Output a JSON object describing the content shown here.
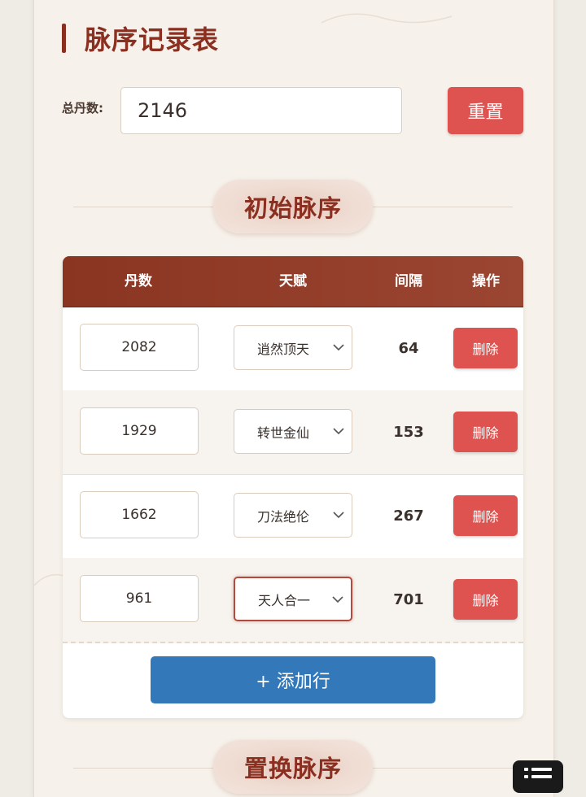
{
  "header": {
    "title": "脉序记录表"
  },
  "total": {
    "label": "总丹数:",
    "value": "2146",
    "reset_label": "重置"
  },
  "initial_section": {
    "title": "初始脉序",
    "columns": [
      "丹数",
      "天赋",
      "间隔",
      "操作"
    ],
    "rows": [
      {
        "dan": "2082",
        "talent": "逍然顶天",
        "gap": "64",
        "delete_label": "删除"
      },
      {
        "dan": "1929",
        "talent": "转世金仙",
        "gap": "153",
        "delete_label": "删除"
      },
      {
        "dan": "1662",
        "talent": "刀法绝伦",
        "gap": "267",
        "delete_label": "删除"
      },
      {
        "dan": "961",
        "talent": "天人合一",
        "gap": "701",
        "delete_label": "删除"
      }
    ],
    "add_row_label": "+ 添加行"
  },
  "replace_section": {
    "title": "置换脉序"
  },
  "colors": {
    "primary": "#8b2f20",
    "danger": "#de5350",
    "accent_blue": "#3379b9",
    "header_bg": "#8a3521"
  }
}
